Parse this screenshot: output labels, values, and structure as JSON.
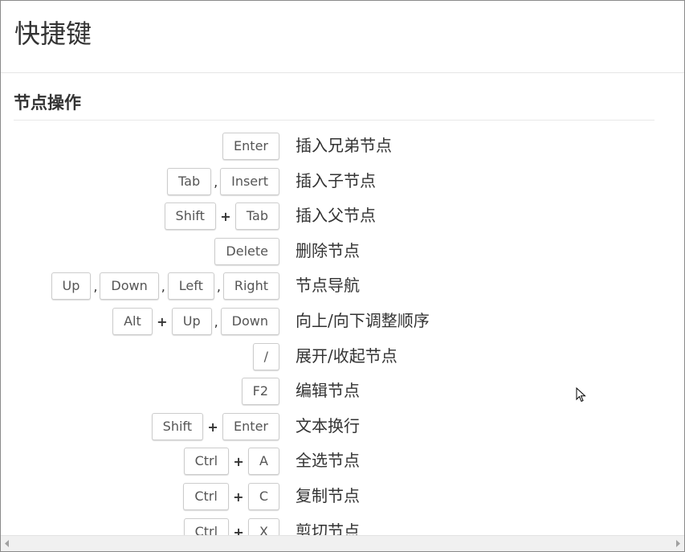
{
  "header": {
    "title": "快捷键"
  },
  "section": {
    "title": "节点操作"
  },
  "shortcuts": [
    {
      "keys": [
        "Enter"
      ],
      "seps": [],
      "desc": "插入兄弟节点"
    },
    {
      "keys": [
        "Tab",
        "Insert"
      ],
      "seps": [
        ","
      ],
      "desc": "插入子节点"
    },
    {
      "keys": [
        "Shift",
        "Tab"
      ],
      "seps": [
        "+"
      ],
      "desc": "插入父节点"
    },
    {
      "keys": [
        "Delete"
      ],
      "seps": [],
      "desc": "删除节点"
    },
    {
      "keys": [
        "Up",
        "Down",
        "Left",
        "Right"
      ],
      "seps": [
        ",",
        ",",
        ","
      ],
      "desc": "节点导航"
    },
    {
      "keys": [
        "Alt",
        "Up",
        "Down"
      ],
      "seps": [
        "+",
        ","
      ],
      "desc": "向上/向下调整顺序"
    },
    {
      "keys": [
        "/"
      ],
      "seps": [],
      "desc": "展开/收起节点"
    },
    {
      "keys": [
        "F2"
      ],
      "seps": [],
      "desc": "编辑节点"
    },
    {
      "keys": [
        "Shift",
        "Enter"
      ],
      "seps": [
        "+"
      ],
      "desc": "文本换行"
    },
    {
      "keys": [
        "Ctrl",
        "A"
      ],
      "seps": [
        "+"
      ],
      "desc": "全选节点"
    },
    {
      "keys": [
        "Ctrl",
        "C"
      ],
      "seps": [
        "+"
      ],
      "desc": "复制节点"
    },
    {
      "keys": [
        "Ctrl",
        "X"
      ],
      "seps": [
        "+"
      ],
      "desc": "剪切节点"
    }
  ],
  "icons": {
    "cursor": "mouse-pointer-icon",
    "scroll_left": "arrow-left-icon",
    "scroll_right": "arrow-right-icon"
  }
}
